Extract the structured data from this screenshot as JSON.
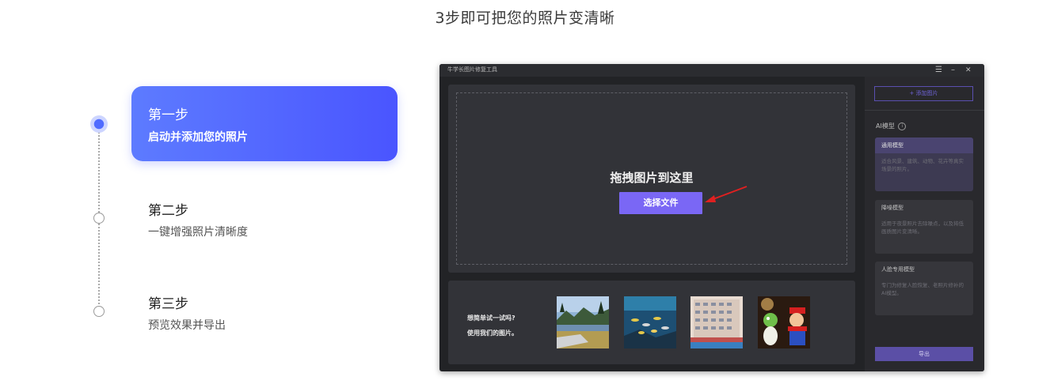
{
  "page_title": "3步即可把您的照片变清晰",
  "steps": [
    {
      "title": "第一步",
      "desc": "启动并添加您的照片",
      "active": true
    },
    {
      "title": "第二步",
      "desc": "一键增强照片清晰度",
      "active": false
    },
    {
      "title": "第三步",
      "desc": "预览效果并导出",
      "active": false
    }
  ],
  "app": {
    "title": "牛学长图片修复工具",
    "window_controls": {
      "menu": "☰",
      "minimize": "–",
      "close": "✕"
    },
    "dropzone": {
      "text": "拖拽图片到这里",
      "button": "选择文件"
    },
    "samples": {
      "line1": "想简单试一试吗?",
      "line2": "使用我们的图片。",
      "thumbnails": [
        "landscape-lake",
        "underwater-fish",
        "apartment-building",
        "toy-figures"
      ]
    },
    "sidebar": {
      "add_button": "+ 添加图片",
      "model_heading": "AI模型",
      "models": [
        {
          "name": "通用模型",
          "desc": "适合风景、建筑、动物、花卉等真实场景的照片。",
          "selected": true
        },
        {
          "name": "降噪模型",
          "desc": "适用于夜景照片去除噪点，以及将低画质图片变清晰。",
          "selected": false
        },
        {
          "name": "人脸专用模型",
          "desc": "专门为修复人脸恢复、老照片修补的AI模型。",
          "selected": false
        }
      ],
      "export_button": "导出"
    }
  },
  "colors": {
    "accent": "#4f5dff",
    "app_background": "#222326",
    "choose_button": "#7a67f5",
    "arrow": "#e02020"
  }
}
